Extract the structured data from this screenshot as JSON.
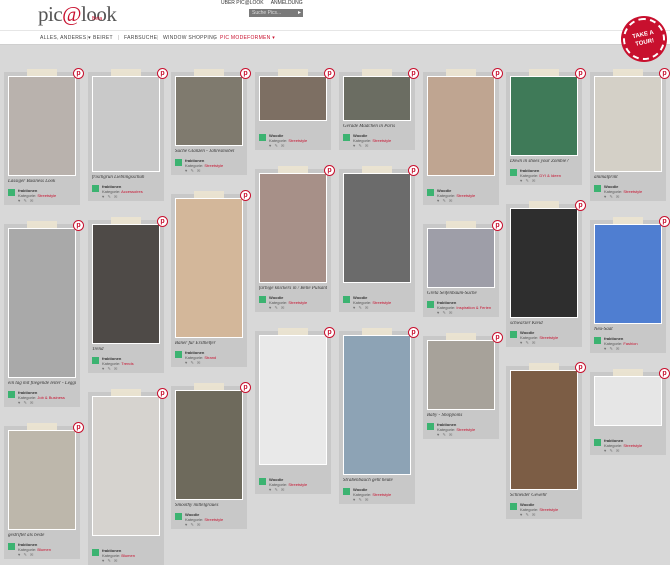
{
  "header": {
    "logo_text": "pic",
    "logo_at": "@",
    "logo_text2": "look",
    "logo_sub": "Beta",
    "top_links": [
      "ÜBER PIC@LOOK",
      "ANMELDUNG"
    ],
    "search_placeholder": "Suche Pics...",
    "tour_label": "TAKE A TOUR!"
  },
  "nav": {
    "items": [
      "ALLES, ANDERES ▾",
      "BEIRET",
      "FARBSUCHE",
      "WINDOW SHOPPING",
      "PIC MODEFORMEN ▾"
    ]
  },
  "colors": {
    "accent": "#c8102e",
    "background": "#d8d8d8"
  },
  "cards": [
    {
      "caption": "Lässiger Business Look",
      "user": "fraktionen",
      "kat": "Streetstyle",
      "photo": "#b9b2ad"
    },
    {
      "caption": "ein tag mit fliegende leiter - Leggins?",
      "user": "fraktionen",
      "kat": "Job & Business",
      "photo": "#a9a9a9"
    },
    {
      "caption": "gestriftet als beste",
      "user": "fraktionen",
      "kat": "Blumen",
      "photo": "#bdb7ab"
    },
    {
      "caption": "frischgrün Lieblingsschuh",
      "user": "fraktionen",
      "kat": "Accessoires",
      "photo": "#c9c9c9"
    },
    {
      "caption": "Trend",
      "user": "fraktionen",
      "kat": "Trends",
      "photo": "#4e4a47"
    },
    {
      "caption": "",
      "user": "fraktionen",
      "kat": "Blumen",
      "photo": "#d6d3cf"
    },
    {
      "caption": "Suche Glänzen - Jahresmöbel",
      "user": "fraktionen",
      "kat": "Streetstyle",
      "photo": "#7f7a6e"
    },
    {
      "caption": "Baner für Ersthelfer",
      "user": "fraktionen",
      "kat": "Strand",
      "photo": "#d3b79a"
    },
    {
      "caption": "Smoothy mittelgraues",
      "user": "Woodie",
      "kat": "Streetstyle",
      "photo": "#6e6a5c"
    },
    {
      "caption": "",
      "user": "Woodie",
      "kat": "Streetstyle",
      "photo": "#7d6f63"
    },
    {
      "caption": "farbige knickers in / Belle Pulsantes Belle Topper",
      "user": "Woodie",
      "kat": "Streetstyle",
      "photo": "#a79088"
    },
    {
      "caption": "",
      "user": "Woodie",
      "kat": "Streetstyle",
      "photo": "#e9e9e9"
    },
    {
      "caption": "Gerade Mädchen in Paris",
      "user": "Woodie",
      "kat": "Streetstyle",
      "photo": "#6b6d62"
    },
    {
      "caption": "",
      "user": "Woodie",
      "kat": "Streetstyle",
      "photo": "#6b6b6b"
    },
    {
      "caption": "Straßenbauch geht heute",
      "user": "Woodie",
      "kat": "Streetstyle",
      "photo": "#8da3b5"
    },
    {
      "caption": "",
      "user": "Woodie",
      "kat": "Streetstyle",
      "photo": "#bfa591"
    },
    {
      "caption": "Greta Seifenbaum-Suche",
      "user": "fraktionen",
      "kat": "Inspiration & Ferien",
      "photo": "#9e9ea8"
    },
    {
      "caption": "Baby - Shoppoins",
      "user": "fraktionen",
      "kat": "Streetstyle",
      "photo": "#a7a29a"
    },
    {
      "caption": "Down in shoes your Zombie?",
      "user": "fraktionen",
      "kat": "DYI & Ideen",
      "photo": "#3f7a58"
    },
    {
      "caption": "schwarzer Kleid",
      "user": "Woodie",
      "kat": "Streetstyle",
      "photo": "#2e2e2e"
    },
    {
      "caption": "Schneider Gewehr",
      "user": "Woodie",
      "kat": "Streetstyle",
      "photo": "#7c5d45"
    },
    {
      "caption": "animalprint",
      "user": "Woodie",
      "kat": "Streetstyle",
      "photo": "#d4d0c7"
    },
    {
      "caption": "Neu-Saat",
      "user": "fraktionen",
      "kat": "Fashion",
      "photo": "#4f7ed1"
    },
    {
      "caption": "",
      "user": "fraktionen",
      "kat": "Streetstyle",
      "photo": "#e6e6e6"
    },
    {
      "caption": "",
      "user": "",
      "kat": "",
      "photo": "#7e6a52"
    },
    {
      "caption": "",
      "user": "",
      "kat": "",
      "photo": "#e8e8e8"
    },
    {
      "caption": "",
      "user": "",
      "kat": "",
      "photo": "#9ab68f"
    },
    {
      "caption": "",
      "user": "",
      "kat": "",
      "photo": "#d0d0d0"
    },
    {
      "caption": "",
      "user": "",
      "kat": "",
      "photo": "#4d4d4d"
    },
    {
      "caption": "",
      "user": "",
      "kat": "",
      "photo": "#c5b8a5"
    }
  ]
}
